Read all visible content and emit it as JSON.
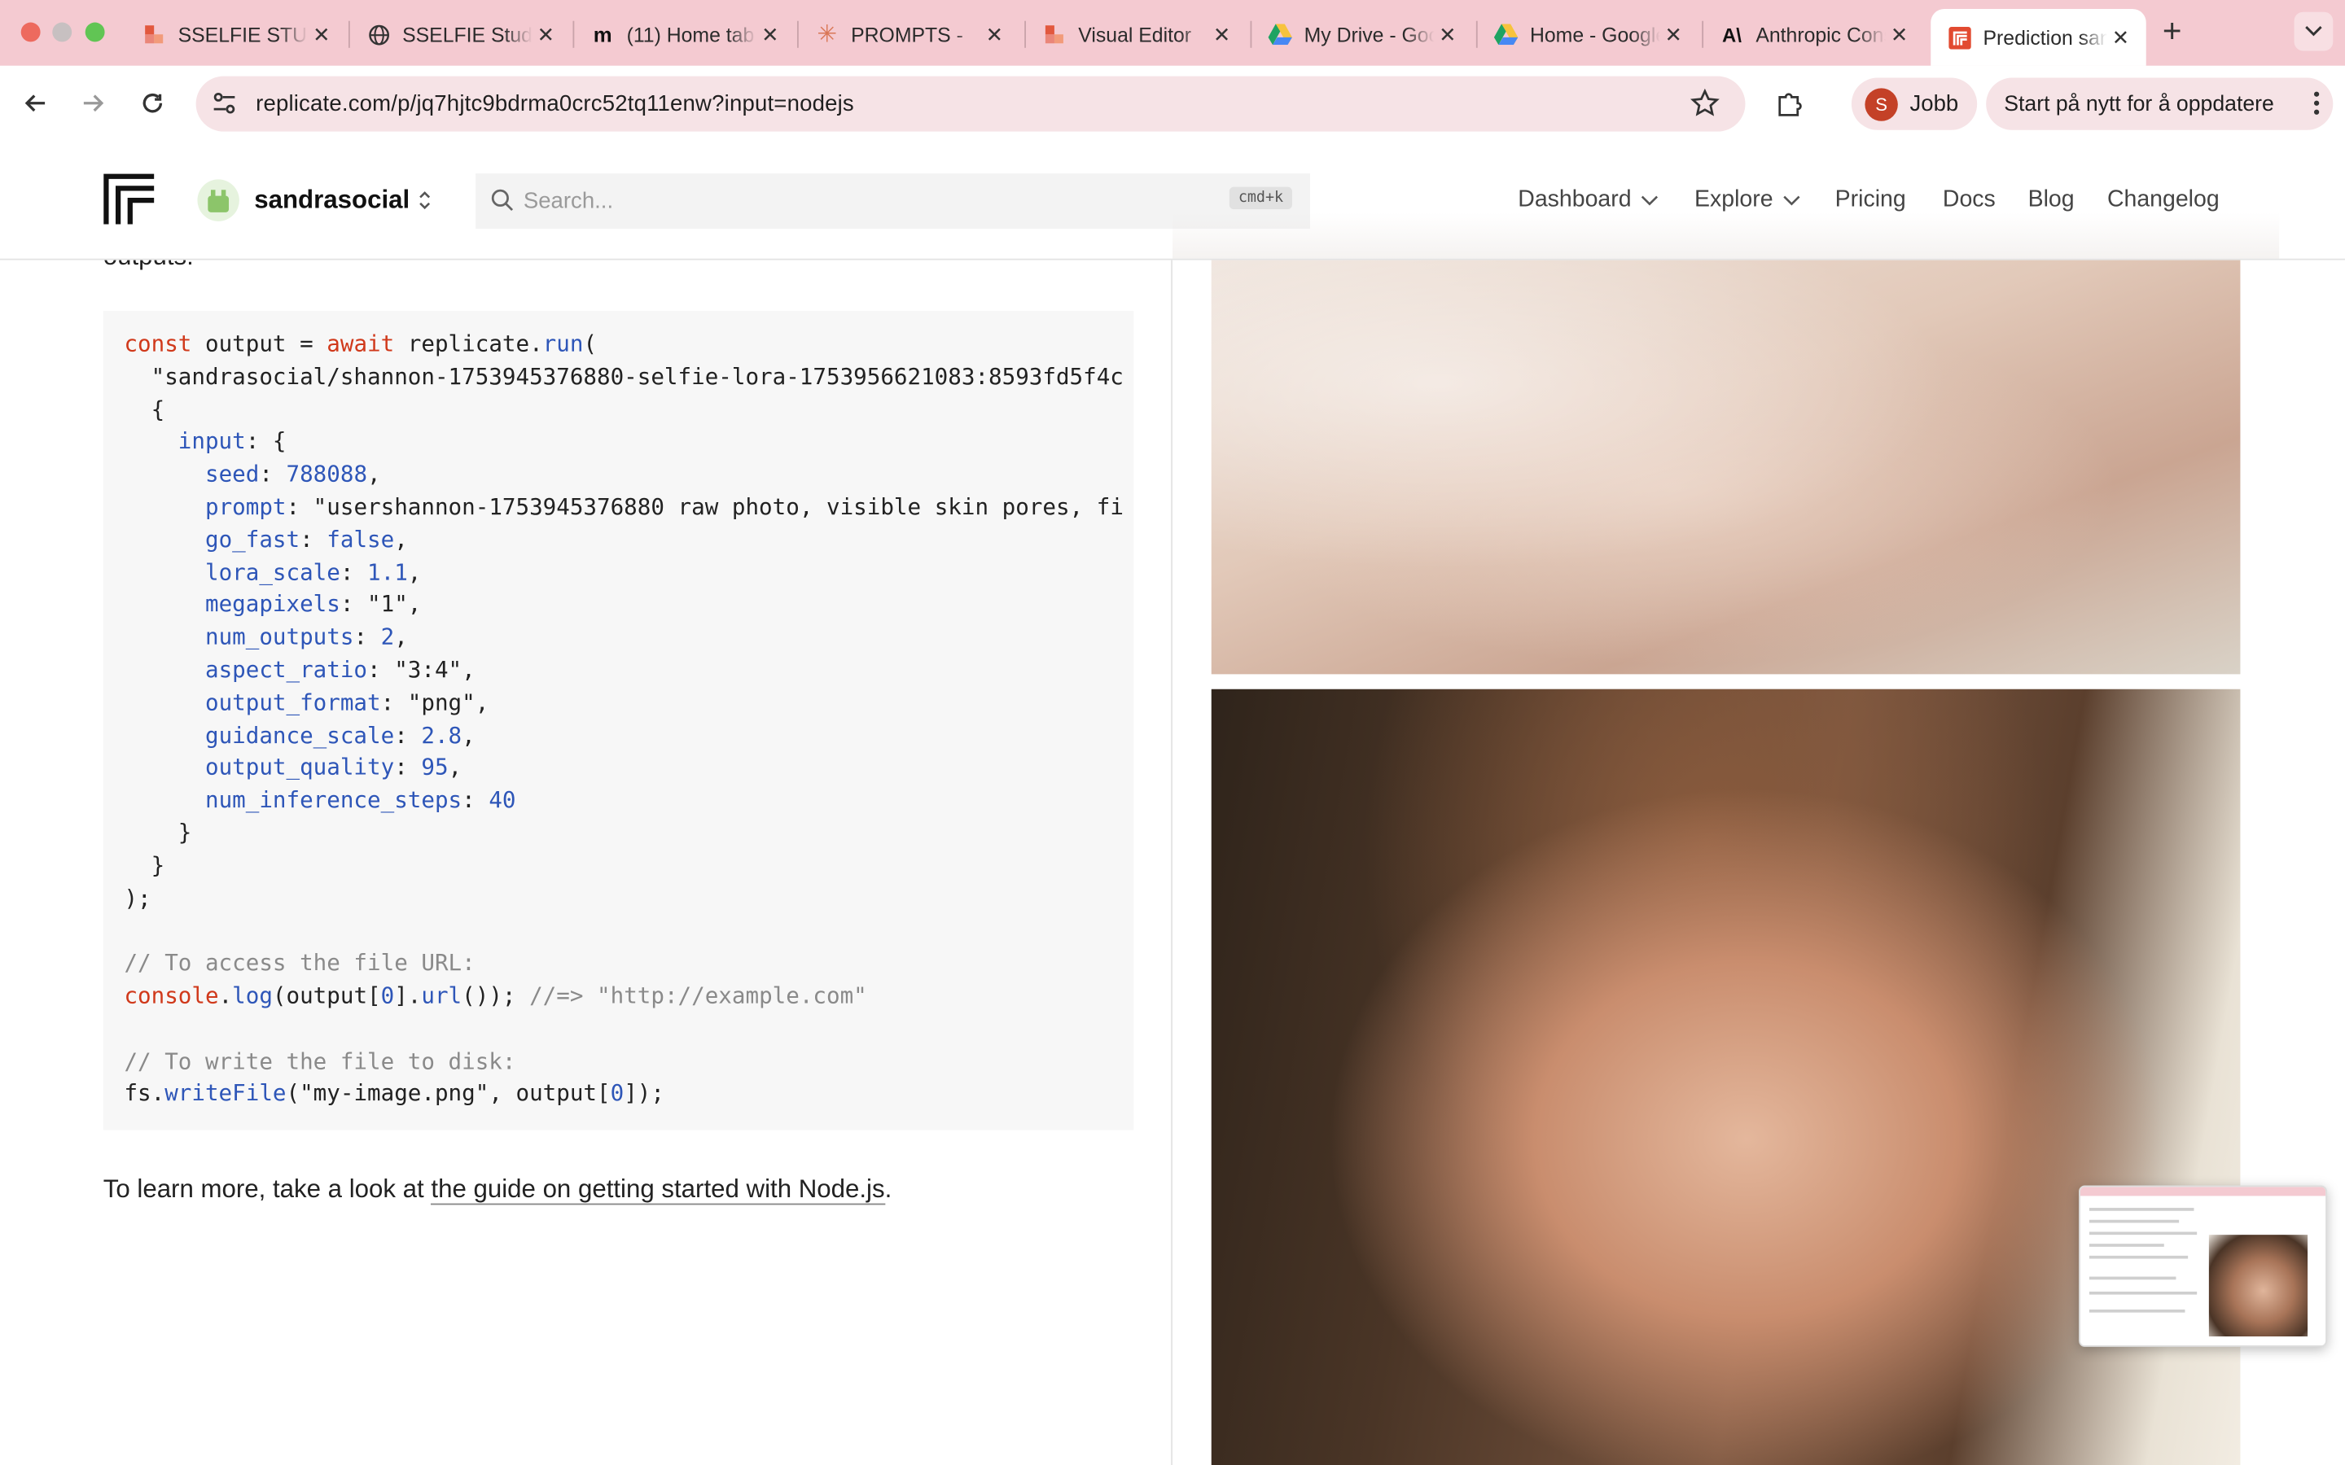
{
  "tabs": [
    {
      "title": "SSELFIE STUDIO",
      "icon": "figma-icon",
      "active": false
    },
    {
      "title": "SSELFIE Studio",
      "icon": "globe-icon",
      "active": false
    },
    {
      "title": "(11) Home tab",
      "icon": "miro-icon",
      "active": false
    },
    {
      "title": "PROMPTS -",
      "icon": "claude-icon",
      "active": false
    },
    {
      "title": "Visual Editor",
      "icon": "figma-icon",
      "active": false
    },
    {
      "title": "My Drive - Google Drive",
      "icon": "drive-icon",
      "active": false
    },
    {
      "title": "Home - Google Drive",
      "icon": "drive-icon",
      "active": false
    },
    {
      "title": "Anthropic Console",
      "icon": "anthropic-icon",
      "active": false
    },
    {
      "title": "Prediction sandrasocial",
      "icon": "replicate-icon",
      "active": true
    }
  ],
  "browser": {
    "url": "replicate.com/p/jq7hjtc9bdrma0crc52tq11enw?input=nodejs",
    "profile_initial": "S",
    "profile_name": "Jobb",
    "update_label": "Start på nytt for å oppdatere"
  },
  "header": {
    "org_name": "sandrasocial",
    "search_placeholder": "Search...",
    "search_shortcut": "cmd+k",
    "nav": [
      "Dashboard",
      "Explore",
      "Pricing",
      "Docs",
      "Blog",
      "Changelog"
    ]
  },
  "content": {
    "partial_line": "outputs:",
    "learn_prefix": "To learn more, take a look at ",
    "learn_link": "the guide on getting started with Node.js",
    "learn_suffix": ".",
    "code": {
      "model_ref": "sandrasocial/shannon-1753945376880-selfie-lora-1753956621083:8593fd5f4c",
      "seed": "788088",
      "prompt": "usershannon-1753945376880 raw photo, visible skin pores, fi",
      "go_fast": "false",
      "lora_scale": "1.1",
      "megapixels": "\"1\"",
      "num_outputs": "2",
      "aspect_ratio": "\"3:4\"",
      "output_format": "\"png\"",
      "guidance_scale": "2.8",
      "output_quality": "95",
      "num_inference_steps": "40",
      "comment_url": "// To access the file URL:",
      "example_result": "//=> \"http://example.com\"",
      "comment_disk": "// To write the file to disk:",
      "filename": "\"my-image.png\""
    }
  }
}
